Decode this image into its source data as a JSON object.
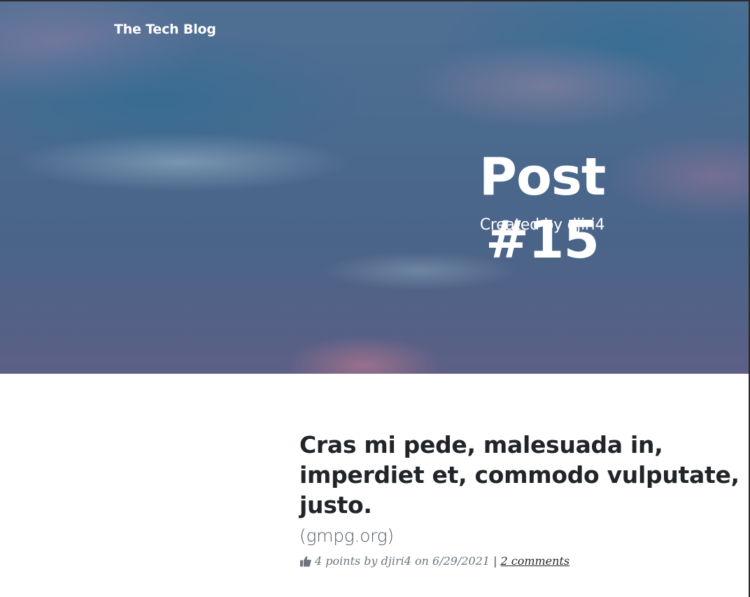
{
  "navbar": {
    "brand": "The Tech Blog"
  },
  "hero": {
    "title": "Post #15",
    "subtitle": "Created by djiri4"
  },
  "post": {
    "heading": "Cras mi pede, malesuada in, imperdiet et, commodo vulputate, justo.",
    "source": "(gmpg.org)",
    "meta": {
      "icon": "thumbs-up-icon",
      "points_text": "4 points by djiri4 on 6/29/2021",
      "separator": "|",
      "comments_link": "2 comments"
    }
  }
}
